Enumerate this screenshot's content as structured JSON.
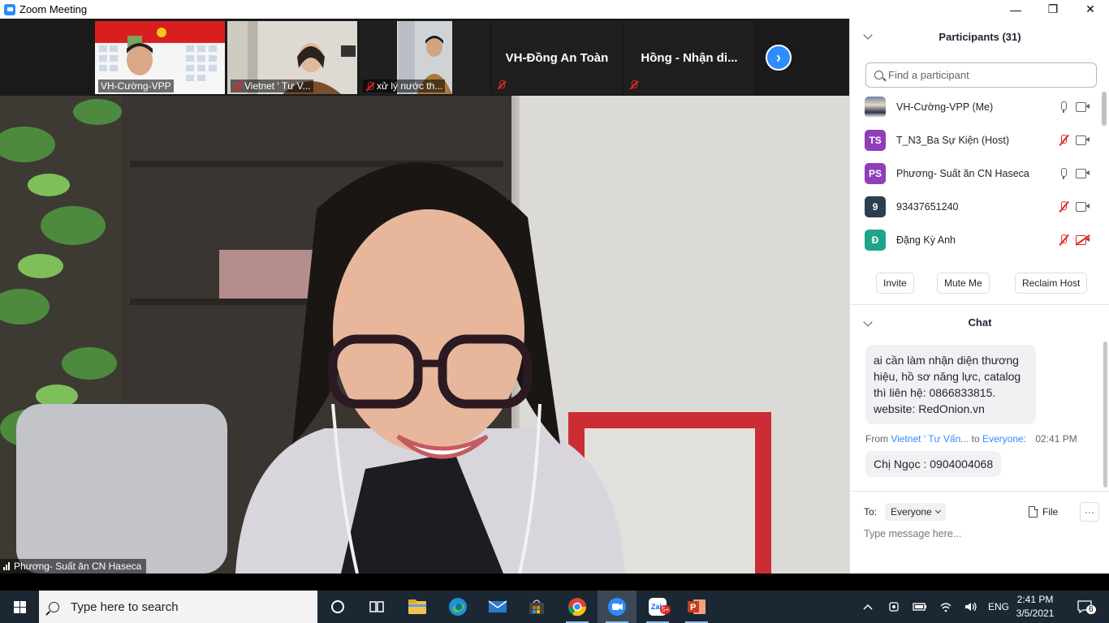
{
  "window": {
    "title": "Zoom Meeting",
    "minimize": "—",
    "maximize": "❐",
    "close": "✕"
  },
  "thumbnails": [
    {
      "name": "VH-Cường-VPP",
      "muted": false
    },
    {
      "name": "Vietnet ' Tư V...",
      "muted": true
    },
    {
      "name": "xử lý nước th...",
      "muted": true
    },
    {
      "name": "VH-Đồng An Toàn",
      "muted": true
    },
    {
      "name": "Hồng - Nhận di...",
      "muted": true
    }
  ],
  "main_video": {
    "speaker_label": "Phương- Suất ăn CN Haseca"
  },
  "participants": {
    "header": "Participants (31)",
    "search_placeholder": "Find a participant",
    "list": [
      {
        "initials": "",
        "name": "VH-Cường-VPP (Me)",
        "avatar_color": "photo",
        "mic": "on",
        "video": "on"
      },
      {
        "initials": "TS",
        "name": "T_N3_Ba Sự Kiện (Host)",
        "avatar_color": "#8f3fb8",
        "mic": "off",
        "video": "on"
      },
      {
        "initials": "PS",
        "name": "Phương- Suất ăn CN Haseca",
        "avatar_color": "#8f3fb8",
        "mic": "on",
        "video": "on"
      },
      {
        "initials": "9",
        "name": "93437651240",
        "avatar_color": "#2c3e50",
        "mic": "off",
        "video": "on"
      },
      {
        "initials": "Đ",
        "name": "Đặng Kỳ Anh",
        "avatar_color": "#1fa38b",
        "mic": "off",
        "video": "off"
      }
    ],
    "buttons": {
      "invite": "Invite",
      "mute_me": "Mute Me",
      "reclaim_host": "Reclaim Host"
    }
  },
  "chat": {
    "header": "Chat",
    "message1": "ai cần làm nhận diện thương hiệu, hồ sơ năng lực, catalog thì liên hệ: 0866833815. website: RedOnion.vn",
    "meta": {
      "from_label": "From",
      "sender": "Vietnet ' Tư Vấn...",
      "to_label": "to",
      "recipient": "Everyone:",
      "time": "02:41 PM"
    },
    "message2": "Chị Ngọc : 0904004068",
    "to_label": "To:",
    "to_value": "Everyone",
    "file_label": "File",
    "more_label": "···",
    "compose_placeholder": "Type message here..."
  },
  "taskbar": {
    "search_placeholder": "Type here to search",
    "language": "ENG",
    "time": "2:41 PM",
    "date": "3/5/2021",
    "notifications": "6",
    "badge": "5+"
  }
}
